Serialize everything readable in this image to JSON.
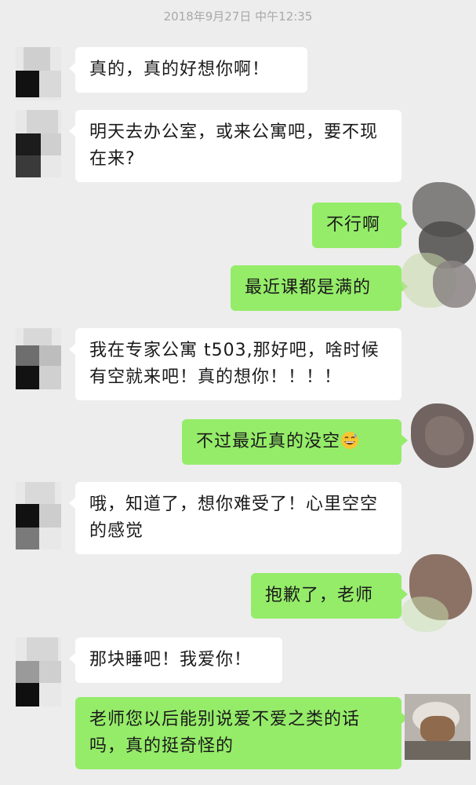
{
  "chat": {
    "timestamp": "2018年9月27日 中午12:35",
    "messages": [
      {
        "side": "in",
        "text": "真的，真的好想你啊！"
      },
      {
        "side": "in",
        "text": "明天去办公室，或来公寓吧，要不现在来?"
      },
      {
        "side": "out",
        "text": "不行啊"
      },
      {
        "side": "out",
        "text": "最近课都是满的"
      },
      {
        "side": "in",
        "text": "我在专家公寓 t503,那好吧，啥时候有空就来吧！真的想你！！！！"
      },
      {
        "side": "out",
        "text": "不过最近真的没空"
      },
      {
        "side": "in",
        "text": "哦，知道了，想你难受了！心里空空的感觉"
      },
      {
        "side": "out",
        "text": "抱歉了，老师"
      },
      {
        "side": "in",
        "text": "那块睡吧！我爱你！"
      },
      {
        "side": "out",
        "text": "老师您以后能别说爱不爱之类的话吗，真的挺奇怪的"
      }
    ]
  },
  "icons": {
    "grin_sweat": "grinning-sweat-emoji-icon"
  },
  "colors": {
    "background": "#ededed",
    "incoming_bubble": "#ffffff",
    "outgoing_bubble": "#95ec69",
    "timestamp_text": "#a9a9a9"
  }
}
